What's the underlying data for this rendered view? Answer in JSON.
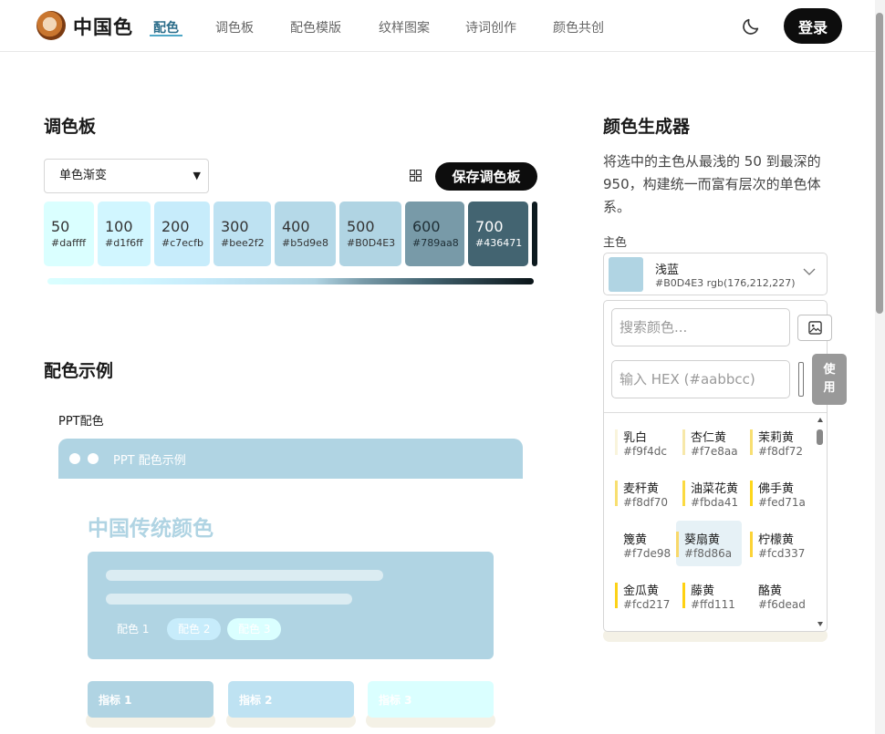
{
  "nav": {
    "brand": "中国色",
    "items": [
      "配色",
      "调色板",
      "配色模版",
      "纹样图案",
      "诗词创作",
      "颜色共创"
    ],
    "login": "登录"
  },
  "palette": {
    "heading": "调色板",
    "mode_select": "单色渐变",
    "save_label": "保存调色板",
    "swatches": [
      {
        "num": "50",
        "hex": "#daffff",
        "bg": "#daffff",
        "fg": "#333333"
      },
      {
        "num": "100",
        "hex": "#d1f6ff",
        "bg": "#d1f6ff",
        "fg": "#333333"
      },
      {
        "num": "200",
        "hex": "#c7ecfb",
        "bg": "#c7ecfb",
        "fg": "#333333"
      },
      {
        "num": "300",
        "hex": "#bee2f2",
        "bg": "#bee2f2",
        "fg": "#333333"
      },
      {
        "num": "400",
        "hex": "#b5d9e8",
        "bg": "#b5d9e8",
        "fg": "#333333"
      },
      {
        "num": "500",
        "hex": "#B0D4E3",
        "bg": "#b0d4e3",
        "fg": "#333333"
      },
      {
        "num": "600",
        "hex": "#789aa8",
        "bg": "#789aa8",
        "fg": "#1f2f36"
      },
      {
        "num": "700",
        "hex": "#436471",
        "bg": "#436471",
        "fg": "#ffffff"
      }
    ]
  },
  "example": {
    "heading": "配色示例",
    "ppt_label": "PPT配色",
    "ppt_bar_title": "PPT 配色示例",
    "ppt_title": "中国传统颜色",
    "chips": [
      "配色 1",
      "配色 2",
      "配色 3"
    ],
    "metrics": [
      "指标 1",
      "指标 2",
      "指标 3"
    ]
  },
  "generator": {
    "heading": "颜色生成器",
    "description": "将选中的主色从最浅的 50 到最深的 950，构建统一而富有层次的单色体系。",
    "main_label": "主色",
    "main_name": "浅蓝",
    "main_sub": "#B0D4E3 rgb(176,212,227)",
    "search_placeholder": "搜索颜色...",
    "hex_placeholder": "输入 HEX (#aabbcc)",
    "use_label": "使用",
    "colors": [
      {
        "name": "乳白",
        "hex": "#f9f4dc",
        "bar": "#f9f4dc"
      },
      {
        "name": "杏仁黄",
        "hex": "#f7e8aa",
        "bar": "#f7e8aa"
      },
      {
        "name": "茉莉黄",
        "hex": "#f8df72",
        "bar": "#f8df72"
      },
      {
        "name": "麦秆黄",
        "hex": "#f8df70",
        "bar": "#f8df70"
      },
      {
        "name": "油菜花黄",
        "hex": "#fbda41",
        "bar": "#fbda41"
      },
      {
        "name": "佛手黄",
        "hex": "#fed71a",
        "bar": "#fed71a"
      },
      {
        "name": "篾黄",
        "hex": "#f7de98",
        "bar": "#f7de98"
      },
      {
        "name": "葵扇黄",
        "hex": "#f8d86a",
        "bar": "#f8d86a"
      },
      {
        "name": "柠檬黄",
        "hex": "#fcd337",
        "bar": "#fcd337"
      },
      {
        "name": "金瓜黄",
        "hex": "#fcd217",
        "bar": "#fcd217"
      },
      {
        "name": "藤黄",
        "hex": "#ffd111",
        "bar": "#ffd111"
      },
      {
        "name": "酪黄",
        "hex": "#f6dead",
        "bar": "#f6dead"
      }
    ]
  }
}
